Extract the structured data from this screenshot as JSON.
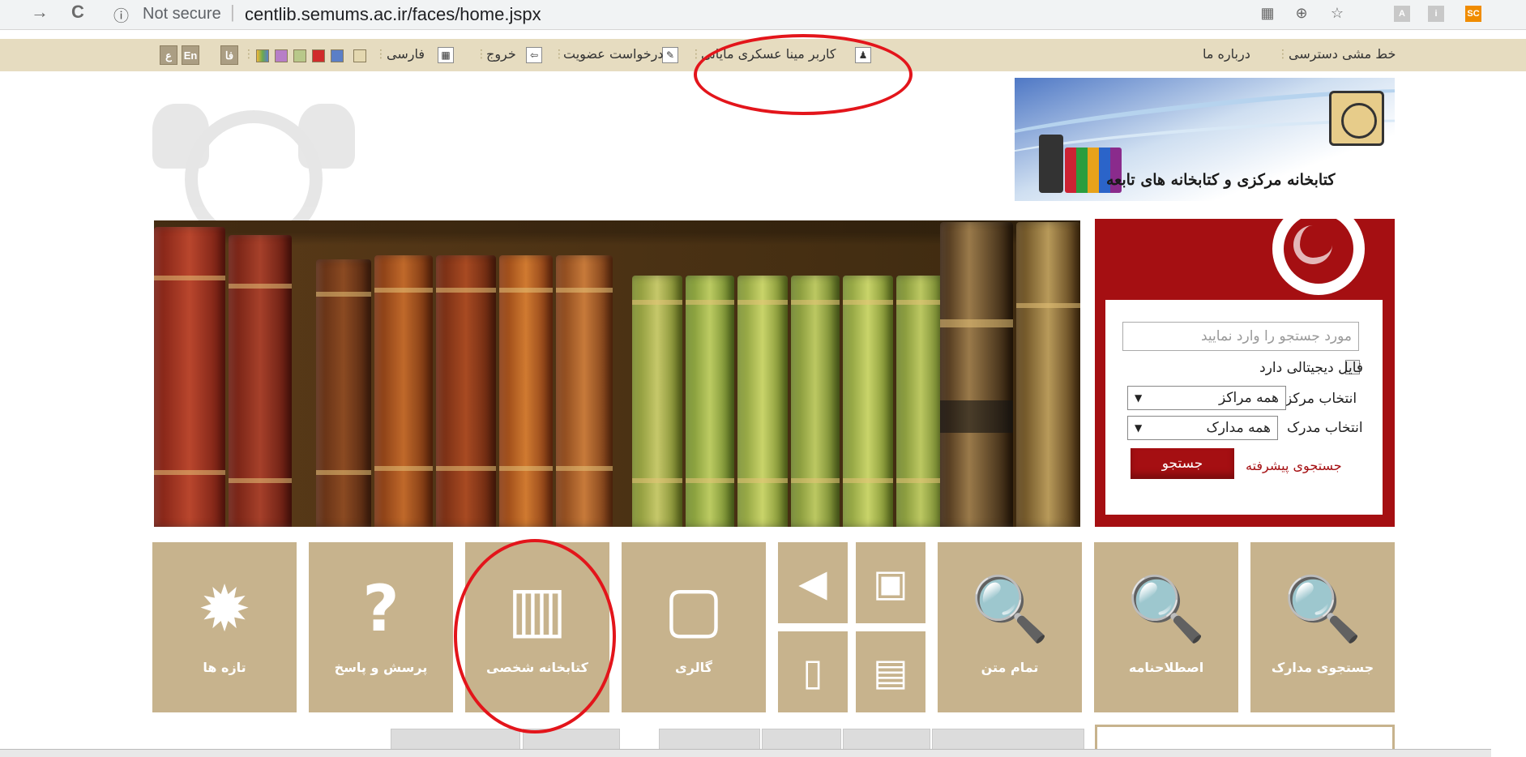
{
  "browser": {
    "forward_icon": "arrow-right-icon",
    "reload_icon": "reload-icon",
    "security_label": "Not secure",
    "url": "centlib.semums.ac.ir/faces/home.jspx",
    "ext_labels": [
      "A",
      "i",
      "SC"
    ]
  },
  "top_strip": {
    "about_us": "درباره ما",
    "access_policy": "خط مشی دسترسی",
    "user": "کاربر مینا عسکری مایانی",
    "membership_request": "درخواست عضویت",
    "logout": "خروج",
    "language_fa": "فارسی",
    "lang_buttons": [
      "ع",
      "En",
      "فا"
    ],
    "swatch_colors": [
      "#e4d8b0",
      "#5b7fc7",
      "#d02b2b",
      "#b8c88a",
      "#b77ec7",
      "#f1b83c"
    ]
  },
  "logo": {
    "title": "کتابخانه مرکزی و کتابخانه های تابعه"
  },
  "search": {
    "placeholder": "مورد جستجو را وارد نمایید",
    "digital_file_label": "فایل دیجیتالی دارد",
    "center_label": "انتخاب مرکز",
    "center_value": "همه مراکز",
    "doc_label": "انتخاب مدرک",
    "doc_value": "همه مدارک",
    "advanced_link": "جستجوی پیشرفته",
    "search_button": "جستجو"
  },
  "tiles": {
    "search_docs": "جستجوی مدارک",
    "thesaurus": "اصطلاحنامه",
    "full_text": "تمام متن",
    "gallery": "گالری",
    "personal_library": "کتابخانه شخصی",
    "qa": "پرسش و پاسخ",
    "new_items": "تازه ها"
  },
  "colors": {
    "accent_red": "#a50f12",
    "tile_tan": "#c7b38d",
    "strip_beige": "#e6dcc0",
    "annotation_red": "#e3151b"
  }
}
